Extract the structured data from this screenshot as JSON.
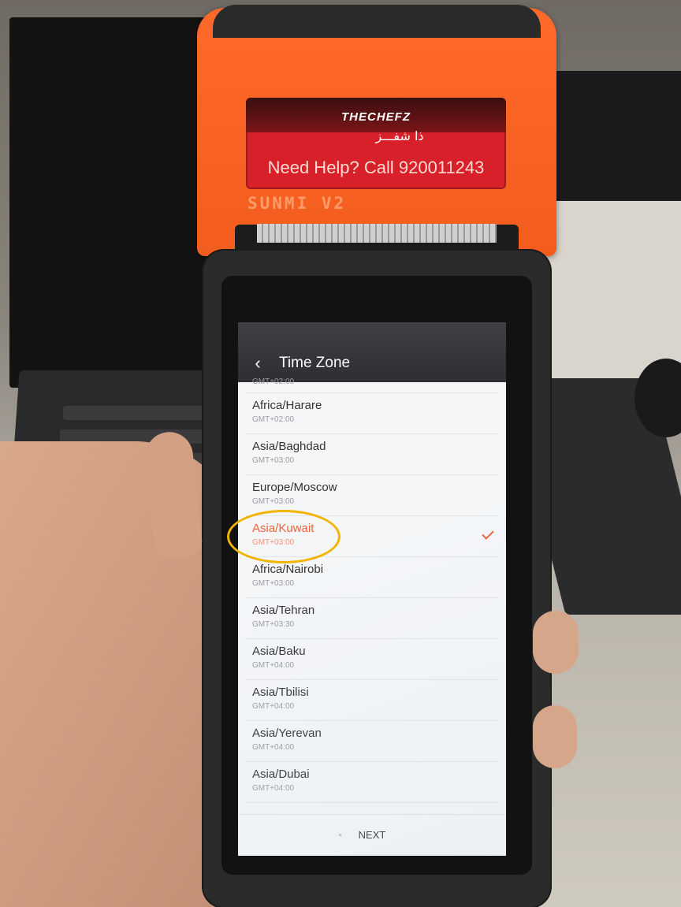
{
  "device": {
    "brand_en": "THECHEFZ",
    "brand_ar": "ذا شفـــز",
    "help_text": "Need Help? Call 920011243",
    "model": "SUNMI V2",
    "accent_color": "#f25c1c"
  },
  "screen": {
    "title": "Time Zone",
    "back_icon": "chevron-left-icon",
    "partial_top_gmt": "GMT+02:00",
    "items": [
      {
        "name": "Africa/Harare",
        "gmt": "GMT+02:00",
        "selected": false
      },
      {
        "name": "Asia/Baghdad",
        "gmt": "GMT+03:00",
        "selected": false
      },
      {
        "name": "Europe/Moscow",
        "gmt": "GMT+03:00",
        "selected": false
      },
      {
        "name": "Asia/Kuwait",
        "gmt": "GMT+03:00",
        "selected": true
      },
      {
        "name": "Africa/Nairobi",
        "gmt": "GMT+03:00",
        "selected": false
      },
      {
        "name": "Asia/Tehran",
        "gmt": "GMT+03:30",
        "selected": false
      },
      {
        "name": "Asia/Baku",
        "gmt": "GMT+04:00",
        "selected": false
      },
      {
        "name": "Asia/Tbilisi",
        "gmt": "GMT+04:00",
        "selected": false
      },
      {
        "name": "Asia/Yerevan",
        "gmt": "GMT+04:00",
        "selected": false
      },
      {
        "name": "Asia/Dubai",
        "gmt": "GMT+04:00",
        "selected": false
      }
    ],
    "selected_color": "#f2623a",
    "footer": {
      "next_label": "NEXT"
    }
  }
}
